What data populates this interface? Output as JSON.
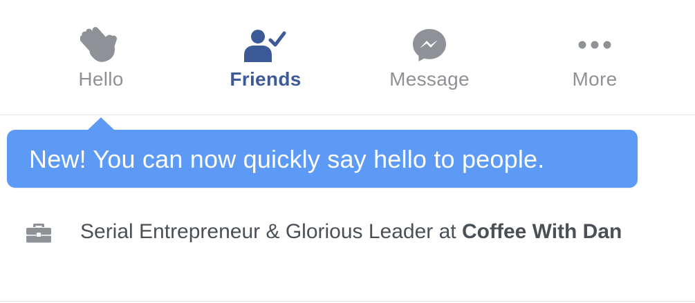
{
  "actions": [
    {
      "label": "Hello",
      "icon": "wave-hand-icon",
      "active": false
    },
    {
      "label": "Friends",
      "icon": "friend-check-icon",
      "active": true
    },
    {
      "label": "Message",
      "icon": "messenger-icon",
      "active": false
    },
    {
      "label": "More",
      "icon": "more-dots-icon",
      "active": false
    }
  ],
  "tooltip": {
    "text": "New! You can now quickly say hello to people."
  },
  "work": {
    "icon": "briefcase-icon",
    "prefix": "Serial Entrepreneur & Glorious Leader at ",
    "company": "Coffee With Dan"
  },
  "colors": {
    "active": "#3d5a98",
    "inactive": "#8e9196",
    "tooltip_bg": "#5c9af5",
    "text": "#4b4f56"
  }
}
